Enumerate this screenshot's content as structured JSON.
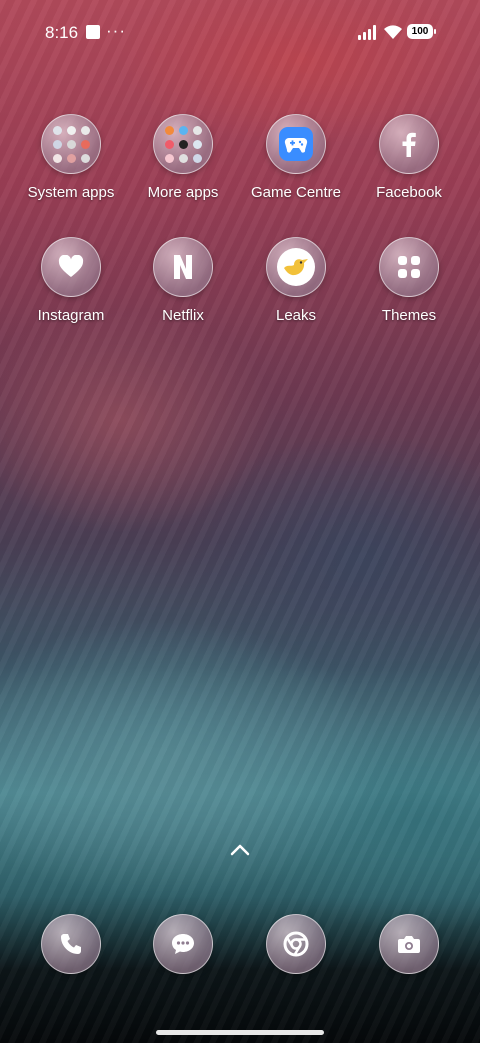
{
  "status_bar": {
    "time": "8:16",
    "more": "···",
    "battery": "100"
  },
  "apps": [
    {
      "id": "system-apps",
      "label": "System apps"
    },
    {
      "id": "more-apps",
      "label": "More apps"
    },
    {
      "id": "game-centre",
      "label": "Game Centre"
    },
    {
      "id": "facebook",
      "label": "Facebook"
    },
    {
      "id": "instagram",
      "label": "Instagram"
    },
    {
      "id": "netflix",
      "label": "Netflix"
    },
    {
      "id": "leaks",
      "label": "Leaks"
    },
    {
      "id": "themes",
      "label": "Themes"
    }
  ],
  "dock": [
    {
      "id": "phone",
      "icon": "phone-icon"
    },
    {
      "id": "messages",
      "icon": "chat-bubble-icon"
    },
    {
      "id": "chrome",
      "icon": "chrome-icon"
    },
    {
      "id": "camera",
      "icon": "camera-icon"
    }
  ],
  "colors": {
    "game_centre": "#3a8dff",
    "leaks_bird": "#f2c13a"
  }
}
